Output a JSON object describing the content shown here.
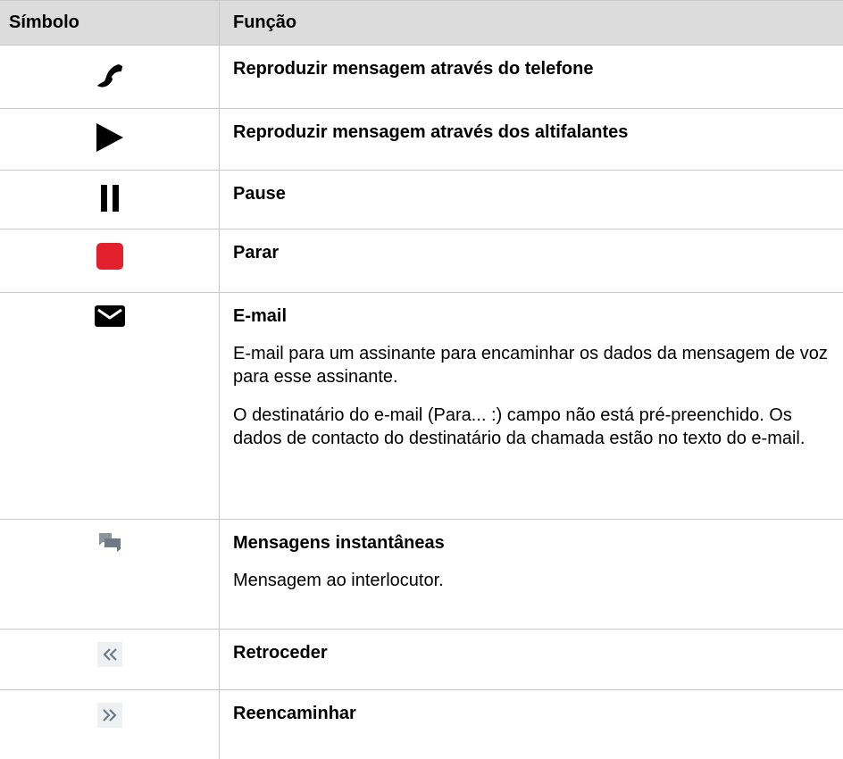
{
  "table": {
    "headers": {
      "symbol": "Símbolo",
      "function": "Função"
    },
    "rows": [
      {
        "icon": "phone-handset-icon",
        "title": "Reproduzir mensagem através do telefone",
        "descriptions": []
      },
      {
        "icon": "play-icon",
        "title": "Reproduzir mensagem através dos altifalantes",
        "descriptions": []
      },
      {
        "icon": "pause-icon",
        "title": "Pause",
        "descriptions": []
      },
      {
        "icon": "stop-icon",
        "title": "Parar",
        "descriptions": []
      },
      {
        "icon": "email-envelope-icon",
        "title": "E-mail",
        "descriptions": [
          "E-mail para um assinante para encaminhar os dados da mensagem de voz para esse assinante.",
          "O destinatário do e-mail (Para... :) campo não está pré-preenchido. Os dados de contacto do destinatário da chamada estão no texto do e-mail."
        ]
      },
      {
        "icon": "chat-bubbles-icon",
        "title": "Mensagens instantâneas",
        "descriptions": [
          "Mensagem ao interlocutor."
        ]
      },
      {
        "icon": "rewind-icon",
        "title": "Retroceder",
        "descriptions": []
      },
      {
        "icon": "forward-icon",
        "title": "Reencaminhar",
        "descriptions": []
      }
    ]
  },
  "colors": {
    "header_bg": "#dcdcdc",
    "stop_red": "#e3202e",
    "chat_gray": "#7f8a93",
    "arrow_gray": "#6c7a86",
    "arrow_bg": "#eef0f2"
  }
}
